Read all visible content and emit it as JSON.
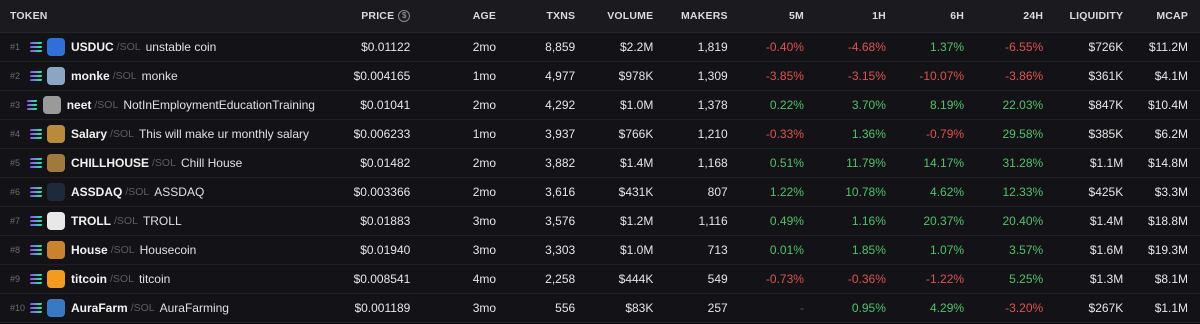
{
  "headers": {
    "token": "TOKEN",
    "price": "PRICE",
    "price_icon": "$",
    "age": "AGE",
    "txns": "TXNS",
    "volume": "VOLUME",
    "makers": "MAKERS",
    "m5": "5M",
    "h1": "1H",
    "h6": "6H",
    "h24": "24H",
    "liquidity": "LIQUIDITY",
    "mcap": "MCAP"
  },
  "quote_label": "/SOL",
  "rows": [
    {
      "rank": "#1",
      "symbol": "USDUC",
      "name": "unstable coin",
      "logo_icon": "usduc-logo-icon",
      "logo_color": "#2e6fd8",
      "price": "$0.01122",
      "age": "2mo",
      "txns": "8,859",
      "volume": "$2.2M",
      "makers": "1,819",
      "m5": "-0.40%",
      "m5_dir": "neg",
      "h1": "-4.68%",
      "h1_dir": "neg",
      "h6": "1.37%",
      "h6_dir": "pos",
      "h24": "-6.55%",
      "h24_dir": "neg",
      "liquidity": "$726K",
      "mcap": "$11.2M"
    },
    {
      "rank": "#2",
      "symbol": "monke",
      "name": "monke",
      "logo_icon": "monke-logo-icon",
      "logo_color": "#8aa6c4",
      "price": "$0.004165",
      "age": "1mo",
      "txns": "4,977",
      "volume": "$978K",
      "makers": "1,309",
      "m5": "-3.85%",
      "m5_dir": "neg",
      "h1": "-3.15%",
      "h1_dir": "neg",
      "h6": "-10.07%",
      "h6_dir": "neg",
      "h24": "-3.86%",
      "h24_dir": "neg",
      "liquidity": "$361K",
      "mcap": "$4.1M"
    },
    {
      "rank": "#3",
      "symbol": "neet",
      "name": "NotInEmploymentEducationTraining",
      "logo_icon": "neet-logo-icon",
      "logo_color": "#9a9a9a",
      "price": "$0.01041",
      "age": "2mo",
      "txns": "4,292",
      "volume": "$1.0M",
      "makers": "1,378",
      "m5": "0.22%",
      "m5_dir": "pos",
      "h1": "3.70%",
      "h1_dir": "pos",
      "h6": "8.19%",
      "h6_dir": "pos",
      "h24": "22.03%",
      "h24_dir": "pos",
      "liquidity": "$847K",
      "mcap": "$10.4M"
    },
    {
      "rank": "#4",
      "symbol": "Salary",
      "name": "This will make ur monthly salary",
      "logo_icon": "salary-logo-icon",
      "logo_color": "#b88a3a",
      "price": "$0.006233",
      "age": "1mo",
      "txns": "3,937",
      "volume": "$766K",
      "makers": "1,210",
      "m5": "-0.33%",
      "m5_dir": "neg",
      "h1": "1.36%",
      "h1_dir": "pos",
      "h6": "-0.79%",
      "h6_dir": "neg",
      "h24": "29.58%",
      "h24_dir": "pos",
      "liquidity": "$385K",
      "mcap": "$6.2M"
    },
    {
      "rank": "#5",
      "symbol": "CHILLHOUSE",
      "name": "Chill House",
      "logo_icon": "chillhouse-logo-icon",
      "logo_color": "#a07a3c",
      "price": "$0.01482",
      "age": "2mo",
      "txns": "3,882",
      "volume": "$1.4M",
      "makers": "1,168",
      "m5": "0.51%",
      "m5_dir": "pos",
      "h1": "11.79%",
      "h1_dir": "pos",
      "h6": "14.17%",
      "h6_dir": "pos",
      "h24": "31.28%",
      "h24_dir": "pos",
      "liquidity": "$1.1M",
      "mcap": "$14.8M"
    },
    {
      "rank": "#6",
      "symbol": "ASSDAQ",
      "name": "ASSDAQ",
      "logo_icon": "assdaq-logo-icon",
      "logo_color": "#1c2a3a",
      "price": "$0.003366",
      "age": "2mo",
      "txns": "3,616",
      "volume": "$431K",
      "makers": "807",
      "m5": "1.22%",
      "m5_dir": "pos",
      "h1": "10.78%",
      "h1_dir": "pos",
      "h6": "4.62%",
      "h6_dir": "pos",
      "h24": "12.33%",
      "h24_dir": "pos",
      "liquidity": "$425K",
      "mcap": "$3.3M"
    },
    {
      "rank": "#7",
      "symbol": "TROLL",
      "name": "TROLL",
      "logo_icon": "troll-logo-icon",
      "logo_color": "#e8e8e8",
      "price": "$0.01883",
      "age": "3mo",
      "txns": "3,576",
      "volume": "$1.2M",
      "makers": "1,116",
      "m5": "0.49%",
      "m5_dir": "pos",
      "h1": "1.16%",
      "h1_dir": "pos",
      "h6": "20.37%",
      "h6_dir": "pos",
      "h24": "20.40%",
      "h24_dir": "pos",
      "liquidity": "$1.4M",
      "mcap": "$18.8M"
    },
    {
      "rank": "#8",
      "symbol": "House",
      "name": "Housecoin",
      "logo_icon": "house-logo-icon",
      "logo_color": "#c9822e",
      "price": "$0.01940",
      "age": "3mo",
      "txns": "3,303",
      "volume": "$1.0M",
      "makers": "713",
      "m5": "0.01%",
      "m5_dir": "pos",
      "h1": "1.85%",
      "h1_dir": "pos",
      "h6": "1.07%",
      "h6_dir": "pos",
      "h24": "3.57%",
      "h24_dir": "pos",
      "liquidity": "$1.6M",
      "mcap": "$19.3M"
    },
    {
      "rank": "#9",
      "symbol": "titcoin",
      "name": "titcoin",
      "logo_icon": "titcoin-logo-icon",
      "logo_color": "#f39a1f",
      "price": "$0.008541",
      "age": "4mo",
      "txns": "2,258",
      "volume": "$444K",
      "makers": "549",
      "m5": "-0.73%",
      "m5_dir": "neg",
      "h1": "-0.36%",
      "h1_dir": "neg",
      "h6": "-1.22%",
      "h6_dir": "neg",
      "h24": "5.25%",
      "h24_dir": "pos",
      "liquidity": "$1.3M",
      "mcap": "$8.1M"
    },
    {
      "rank": "#10",
      "symbol": "AuraFarm",
      "name": "AuraFarming",
      "logo_icon": "aurafarm-logo-icon",
      "logo_color": "#3a78c4",
      "price": "$0.001189",
      "age": "3mo",
      "txns": "556",
      "volume": "$83K",
      "makers": "257",
      "m5": "-",
      "m5_dir": "neutral",
      "h1": "0.95%",
      "h1_dir": "pos",
      "h6": "4.29%",
      "h6_dir": "pos",
      "h24": "-3.20%",
      "h24_dir": "neg",
      "liquidity": "$267K",
      "mcap": "$1.1M"
    }
  ]
}
